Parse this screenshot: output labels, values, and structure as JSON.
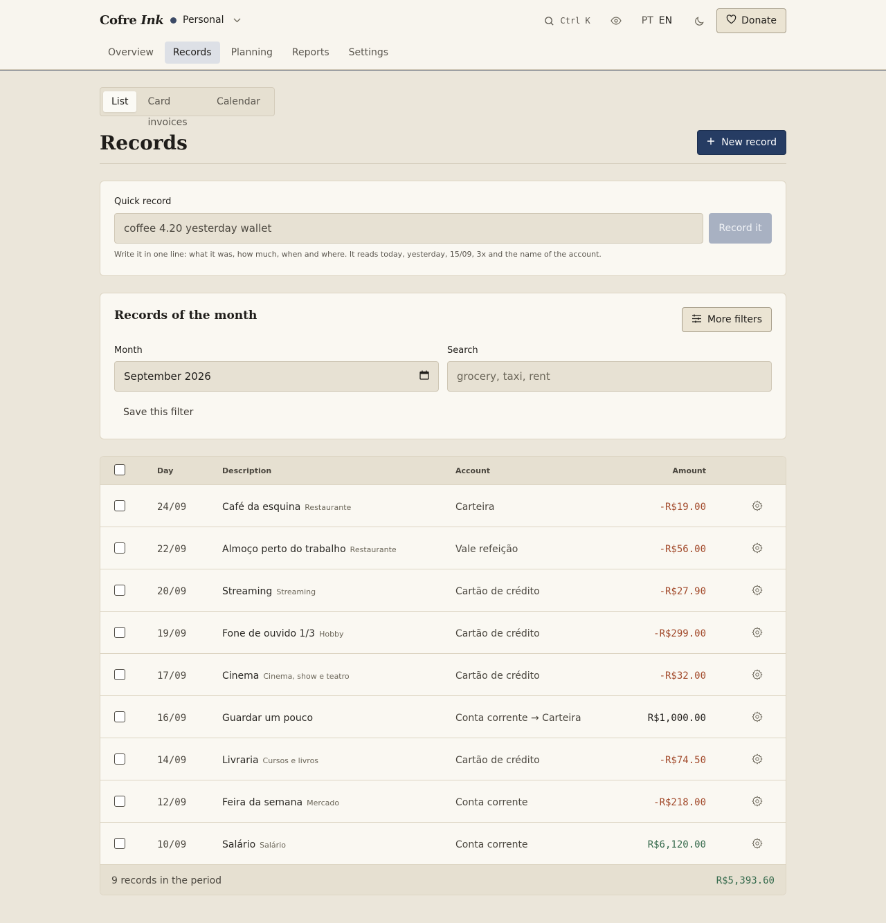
{
  "header": {
    "brand_plain": "Cofre",
    "brand_italic": "Ink",
    "workspace": "Personal",
    "search_shortcut": "Ctrl K",
    "lang_pt": "PT",
    "lang_en": "EN",
    "donate_label": "Donate"
  },
  "nav": {
    "items": [
      {
        "label": "Overview"
      },
      {
        "label": "Records"
      },
      {
        "label": "Planning"
      },
      {
        "label": "Reports"
      },
      {
        "label": "Settings"
      }
    ]
  },
  "subtabs": {
    "items": [
      {
        "label": "List"
      },
      {
        "label": "Card invoices"
      },
      {
        "label": "Calendar"
      }
    ]
  },
  "page": {
    "title": "Records",
    "new_record_label": "New record"
  },
  "quick_record": {
    "label": "Quick record",
    "value": "coffee 4.20 yesterday wallet",
    "button": "Record it",
    "hint": "Write it in one line: what it was, how much, when and where. It reads today, yesterday, 15/09, 3x and the name of the account."
  },
  "filters": {
    "title": "Records of the month",
    "more_filters": "More filters",
    "month_label": "Month",
    "month_value": "September 2026",
    "search_label": "Search",
    "search_placeholder": "grocery, taxi, rent",
    "save_filter": "Save this filter"
  },
  "table": {
    "headers": {
      "day": "Day",
      "description": "Description",
      "account": "Account",
      "amount": "Amount"
    },
    "rows": [
      {
        "day": "24/09",
        "description": "Café da esquina",
        "category": "Restaurante",
        "account": "Carteira",
        "amount": "-R$19.00"
      },
      {
        "day": "22/09",
        "description": "Almoço perto do trabalho",
        "category": "Restaurante",
        "account": "Vale refeição",
        "amount": "-R$56.00"
      },
      {
        "day": "20/09",
        "description": "Streaming",
        "category": "Streaming",
        "account": "Cartão de crédito",
        "amount": "-R$27.90"
      },
      {
        "day": "19/09",
        "description": "Fone de ouvido 1/3",
        "category": "Hobby",
        "account": "Cartão de crédito",
        "amount": "-R$299.00"
      },
      {
        "day": "17/09",
        "description": "Cinema",
        "category": "Cinema, show e teatro",
        "account": "Cartão de crédito",
        "amount": "-R$32.00"
      },
      {
        "day": "16/09",
        "description": "Guardar um pouco",
        "category": "",
        "account": "Conta corrente → Carteira",
        "amount": "R$1,000.00"
      },
      {
        "day": "14/09",
        "description": "Livraria",
        "category": "Cursos e livros",
        "account": "Cartão de crédito",
        "amount": "-R$74.50"
      },
      {
        "day": "12/09",
        "description": "Feira da semana",
        "category": "Mercado",
        "account": "Conta corrente",
        "amount": "-R$218.00"
      },
      {
        "day": "10/09",
        "description": "Salário",
        "category": "Salário",
        "account": "Conta corrente",
        "amount": "R$6,120.00"
      }
    ],
    "footer_count": "9 records in the period",
    "footer_total": "R$5,393.60"
  },
  "colors": {
    "accent": "#263c63",
    "negative": "#a24a2b",
    "positive": "#356a4c",
    "background": "#ebe6da"
  },
  "icons": [
    "search-icon",
    "eye-icon",
    "moon-icon",
    "heart-icon",
    "plus-icon",
    "sliders-icon",
    "calendar-icon",
    "gear-icon",
    "chevron-down-icon"
  ]
}
